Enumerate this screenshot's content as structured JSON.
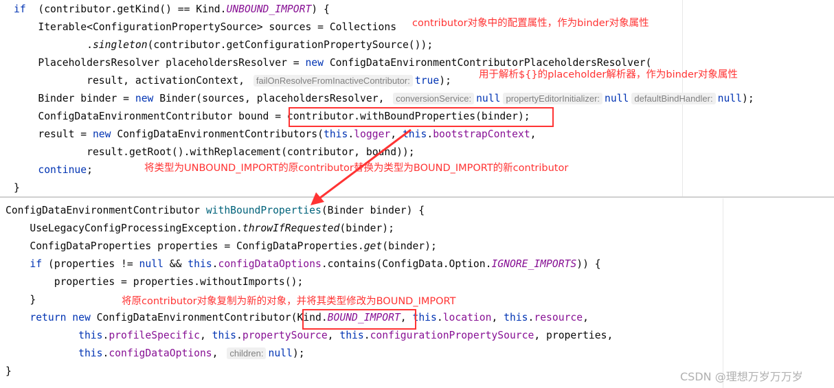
{
  "top_code": [
    [
      [
        "kw",
        "if"
      ],
      [
        "",
        "  (contributor.getKind() == Kind."
      ],
      [
        "st",
        "UNBOUND_IMPORT"
      ],
      [
        "",
        ") {"
      ]
    ],
    [
      [
        "",
        "    Iterable<ConfigurationPropertySource> sources = Collections"
      ]
    ],
    [
      [
        "",
        "            ."
      ],
      [
        "it",
        "singleton"
      ],
      [
        "",
        "(contributor.getConfigurationPropertySource());"
      ]
    ],
    [
      [
        "",
        "    PlaceholdersResolver placeholdersResolver = "
      ],
      [
        "kw",
        "new"
      ],
      [
        "",
        " ConfigDataEnvironmentContributorPlaceholdersResolver("
      ]
    ],
    [
      [
        "",
        "            result, activationContext, "
      ],
      [
        "hint",
        "failOnResolveFromInactiveContributor:"
      ],
      [
        "kw",
        "true"
      ],
      [
        "",
        ");"
      ]
    ],
    [
      [
        "",
        "    Binder binder = "
      ],
      [
        "kw",
        "new"
      ],
      [
        "",
        " Binder(sources, placeholdersResolver, "
      ],
      [
        "hint",
        "conversionService:"
      ],
      [
        "kw",
        "null"
      ],
      [
        ",  "
      ],
      [
        "hint",
        "propertyEditorInitializer:"
      ],
      [
        "kw",
        "null"
      ],
      [
        ",  "
      ],
      [
        "hint",
        "defaultBindHandler:"
      ],
      [
        "kw",
        "null"
      ],
      [
        "",
        ");"
      ]
    ],
    [
      [
        "",
        "    ConfigDataEnvironmentContributor bound = contributor.withBoundProperties(binder);"
      ]
    ],
    [
      [
        "",
        "    result = "
      ],
      [
        "kw",
        "new"
      ],
      [
        "",
        " ConfigDataEnvironmentContributors("
      ],
      [
        "kw",
        "this"
      ],
      [
        "",
        "."
      ],
      [
        "fd",
        "logger"
      ],
      [
        "",
        ", "
      ],
      [
        "kw",
        "this"
      ],
      [
        "",
        "."
      ],
      [
        "fd",
        "bootstrapContext"
      ],
      [
        "",
        ","
      ]
    ],
    [
      [
        "",
        "            result.getRoot().withReplacement(contributor, bound));"
      ]
    ],
    [
      [
        "kw",
        "    continue"
      ],
      [
        "",
        ";"
      ]
    ],
    [
      [
        "",
        "}"
      ]
    ]
  ],
  "bottom_code": [
    [
      [
        "",
        "ConfigDataEnvironmentContributor "
      ],
      [
        "md",
        "withBoundProperties"
      ],
      [
        "",
        "(Binder binder) {"
      ]
    ],
    [
      [
        "",
        "    UseLegacyConfigProcessingException."
      ],
      [
        "it",
        "throwIfRequested"
      ],
      [
        "",
        "(binder);"
      ]
    ],
    [
      [
        "",
        "    ConfigDataProperties properties = ConfigDataProperties."
      ],
      [
        "it",
        "get"
      ],
      [
        "",
        "(binder);"
      ]
    ],
    [
      [
        "kw",
        "    if"
      ],
      [
        "",
        " (properties != "
      ],
      [
        "kw",
        "null"
      ],
      [
        "",
        " && "
      ],
      [
        "kw",
        "this"
      ],
      [
        "",
        "."
      ],
      [
        "fd",
        "configDataOptions"
      ],
      [
        "",
        ".contains(ConfigData.Option."
      ],
      [
        "st",
        "IGNORE_IMPORTS"
      ],
      [
        "",
        ")) {"
      ]
    ],
    [
      [
        "",
        "        properties = properties.withoutImports();"
      ]
    ],
    [
      [
        "",
        "    }"
      ]
    ],
    [
      [
        "kw",
        "    return new"
      ],
      [
        "",
        " ConfigDataEnvironmentContributor(Kind."
      ],
      [
        "st",
        "BOUND_IMPORT"
      ],
      [
        "",
        ", "
      ],
      [
        "kw",
        "this"
      ],
      [
        "",
        "."
      ],
      [
        "fd",
        "location"
      ],
      [
        "",
        ", "
      ],
      [
        "kw",
        "this"
      ],
      [
        "",
        "."
      ],
      [
        "fd",
        "resource"
      ],
      [
        "",
        ","
      ]
    ],
    [
      [
        "kw",
        "            this"
      ],
      [
        "",
        "."
      ],
      [
        "fd",
        "profileSpecific"
      ],
      [
        "",
        ", "
      ],
      [
        "kw",
        "this"
      ],
      [
        "",
        "."
      ],
      [
        "fd",
        "propertySource"
      ],
      [
        "",
        ", "
      ],
      [
        "kw",
        "this"
      ],
      [
        "",
        "."
      ],
      [
        "fd",
        "configurationPropertySource"
      ],
      [
        "",
        ", properties,"
      ]
    ],
    [
      [
        "kw",
        "            this"
      ],
      [
        "",
        "."
      ],
      [
        "fd",
        "configDataOptions"
      ],
      [
        "",
        ", "
      ],
      [
        "hint",
        "children:"
      ],
      [
        "kw",
        "null"
      ],
      [
        "",
        ");"
      ]
    ],
    [
      [
        "",
        "}"
      ]
    ]
  ],
  "annotations": {
    "note1": "contributor对象中的配置属性，作为binder对象属性",
    "note2": "用于解析${}的placeholder解析器，作为binder对象属性",
    "note3": "将类型为UNBOUND_IMPORT的原contributor替换为类型为BOUND_IMPORT的新contributor",
    "note4": "将原contributor对象复制为新的对象，并将其类型修改为BOUND_IMPORT"
  },
  "watermark": "CSDN @理想万岁万万岁",
  "colors": {
    "annotation": "#ff3333",
    "keyword": "#0033b3",
    "field": "#871094",
    "method": "#00627a"
  }
}
